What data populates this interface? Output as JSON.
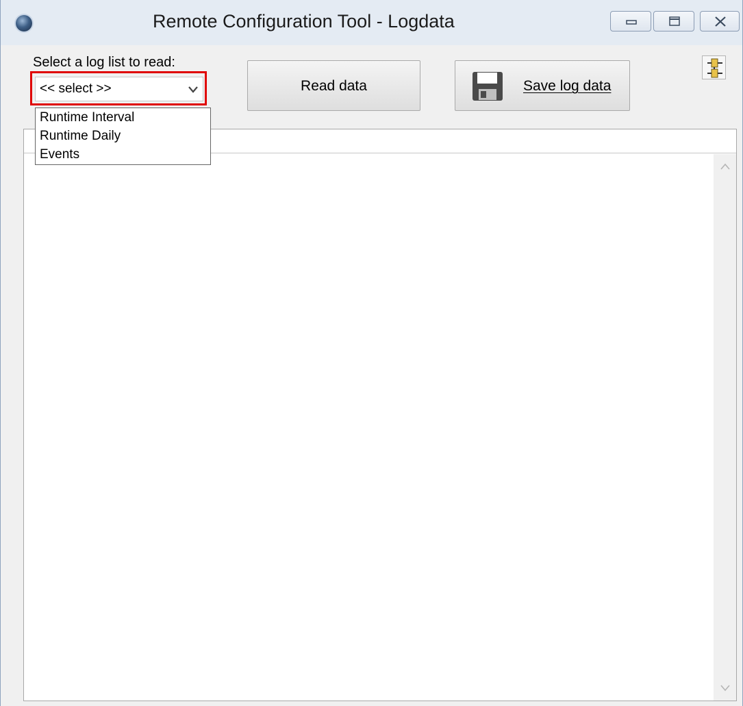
{
  "window": {
    "title": "Remote Configuration Tool - Logdata"
  },
  "controls": {
    "select_label": "Select a log list to read:",
    "combo_value": "<< select >>",
    "read_button_label": "Read data",
    "save_button_label": "Save log data",
    "save_button_mnemonic": "S"
  },
  "dropdown": {
    "options": [
      "Runtime Interval",
      "Runtime Daily",
      "Events"
    ]
  },
  "icons": {
    "app": "app-globe-icon",
    "minimize": "minimize-icon",
    "maximize": "maximize-icon",
    "close": "close-icon",
    "combo_arrow": "chevron-down-icon",
    "save": "floppy-disk-icon",
    "settings": "connection-settings-icon",
    "scroll_up": "scroll-up-arrow-icon",
    "scroll_down": "scroll-down-arrow-icon"
  },
  "colors": {
    "highlight": "#e00000",
    "titlebar": "#e4ebf3",
    "window_bg": "#f0f0f0"
  }
}
